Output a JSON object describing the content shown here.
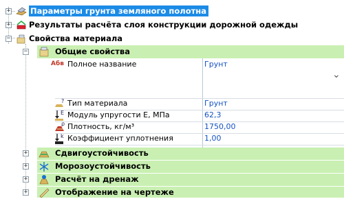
{
  "tree": {
    "expander_plus": "+",
    "expander_minus": "−",
    "nodes": {
      "subgrade": {
        "label": "Параметры грунта земляного полотна"
      },
      "calc_results": {
        "label": "Результаты расчёта слоя конструкции дорожной одежды"
      },
      "material": {
        "label": "Свойства материала"
      },
      "general": {
        "label": "Общие свойства"
      },
      "shear": {
        "label": "Сдвигоустойчивость"
      },
      "frost": {
        "label": "Морозоустойчивость"
      },
      "drain": {
        "label": "Расчёт на дренаж"
      },
      "drawing": {
        "label": "Отображение на чертеже"
      }
    }
  },
  "properties": {
    "full_name": {
      "icon_text": "Абв",
      "label": "Полное название",
      "value": "Грунт",
      "dropdown_glyph": "⌄"
    },
    "material_type": {
      "icon_text": "?",
      "label": "Тип материала",
      "value": "Грунт"
    },
    "modulus": {
      "icon_text": "E",
      "label": "Модуль упругости Е, МПа",
      "value": "62,3"
    },
    "density": {
      "icon_text": "ρ",
      "label": "Плотность, кг/м³",
      "value": "1750,00"
    },
    "compaction": {
      "icon_text": "k",
      "label": "Коэффициент уплотнения",
      "value": "1,00"
    }
  },
  "colors": {
    "selection": "#1c8be6",
    "group_band": "#c9f0b2",
    "value_text": "#1552c2"
  }
}
